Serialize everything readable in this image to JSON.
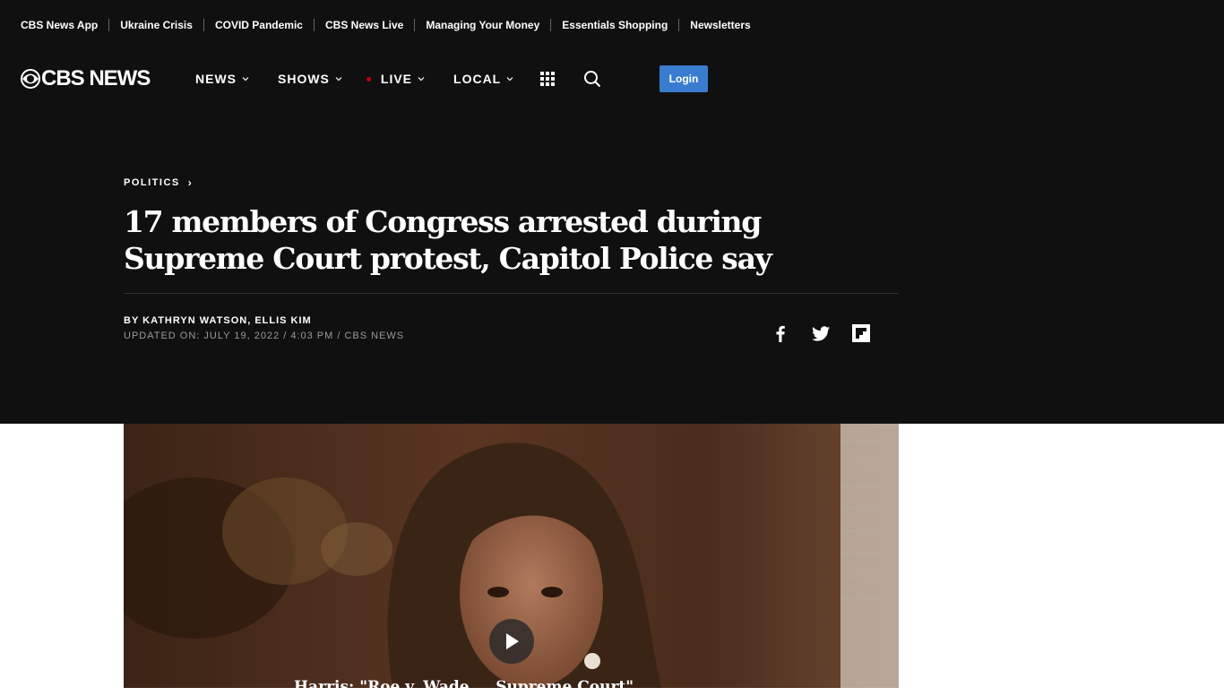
{
  "toplinks": [
    "CBS News App",
    "Ukraine Crisis",
    "COVID Pandemic",
    "CBS News Live",
    "Managing Your Money",
    "Essentials Shopping",
    "Newsletters"
  ],
  "logo": {
    "text": "CBS NEWS"
  },
  "nav": {
    "news": "NEWS",
    "shows": "SHOWS",
    "live": "LIVE",
    "local": "LOCAL",
    "login": "Login"
  },
  "article": {
    "kicker": "POLITICS",
    "headline_line1": "17 members of Congress arrested during",
    "headline_line2": "Supreme Court protest, Capitol Police say",
    "byline": "BY KATHRYN WATSON, ELLIS KIM",
    "dateline": "UPDATED ON: JULY 19, 2022 / 4:03 PM / CBS NEWS"
  },
  "video": {
    "caption": "Harris: \"Roe v. Wade ... Supreme Court\" ..."
  },
  "icons": {
    "grid": "grid-icon",
    "search": "search-icon",
    "facebook": "facebook-icon",
    "twitter": "twitter-icon",
    "flipboard": "flipboard-icon",
    "play": "play-icon"
  },
  "colors": {
    "header_bg": "#101010",
    "login_bg": "#3a7ccf",
    "live_dot": "#c2000b"
  }
}
